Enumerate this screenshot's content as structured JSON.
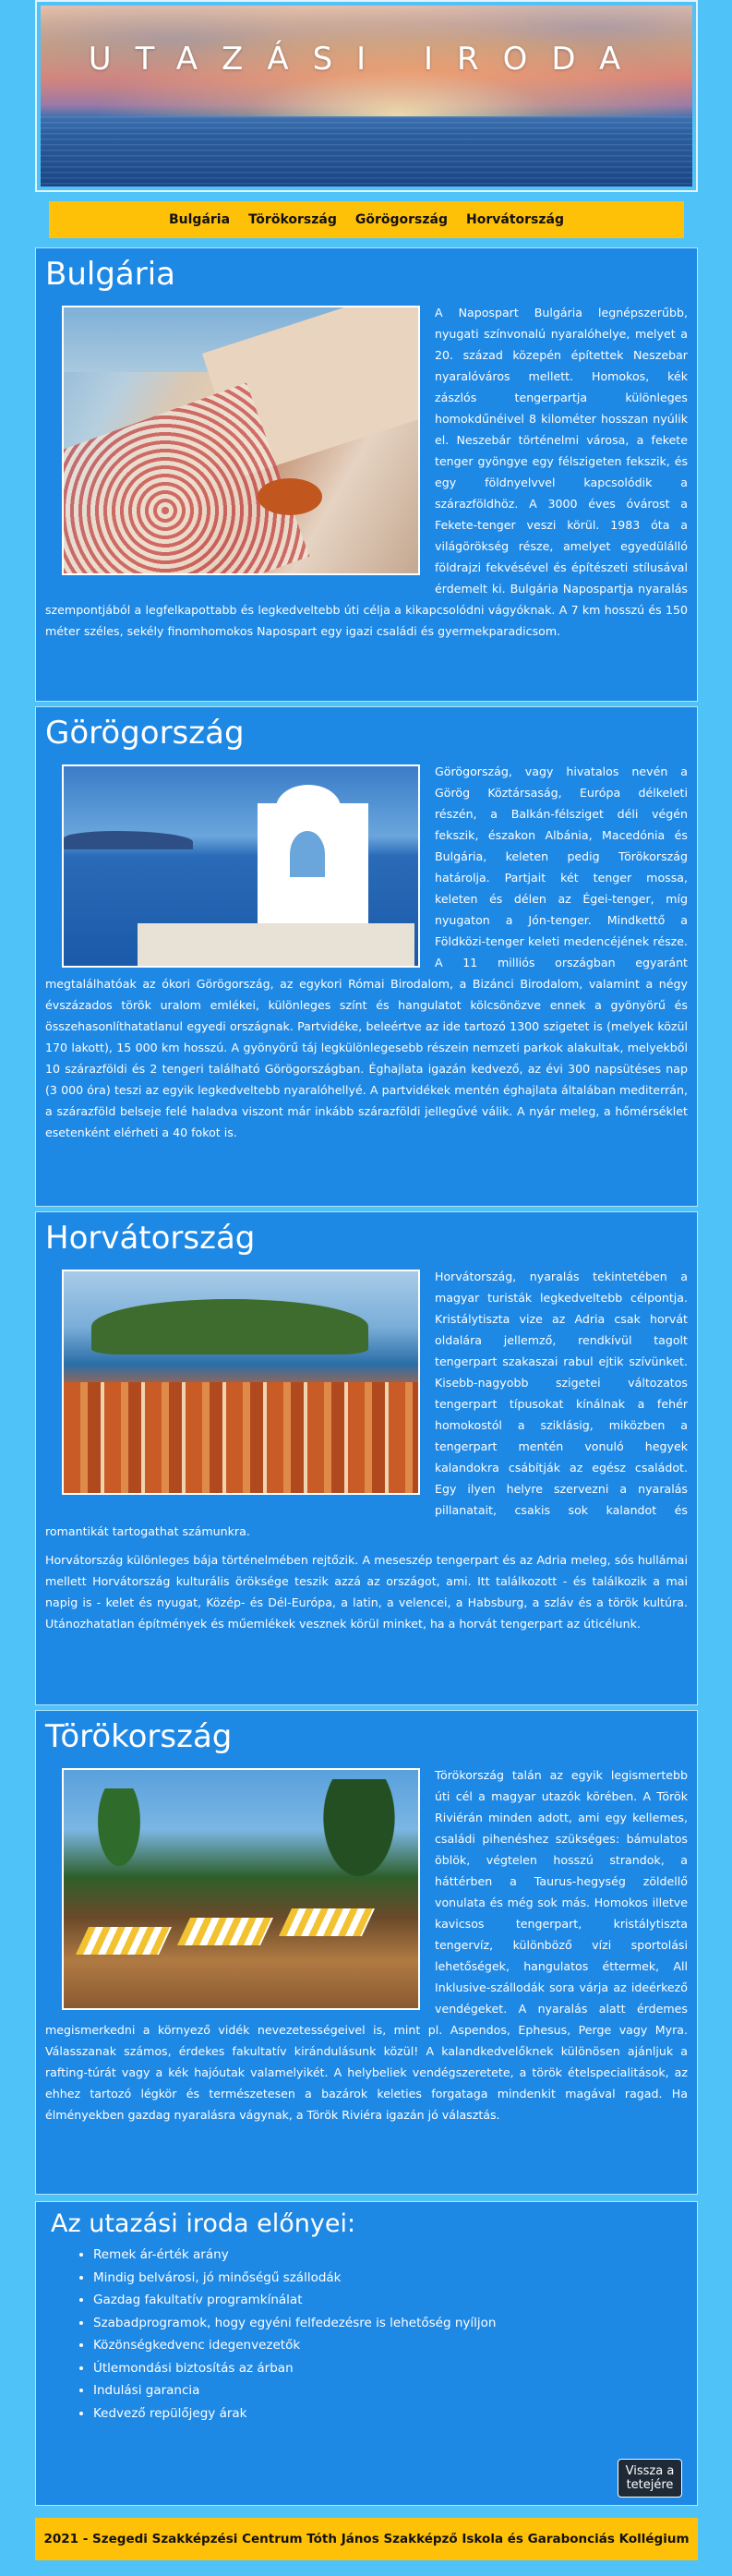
{
  "header": {
    "title": "UTAZÁSI IRODA"
  },
  "nav": [
    "Bulgária",
    "Törökország",
    "Görögország",
    "Horvátország"
  ],
  "sections": {
    "bulgaria": {
      "title": "Bulgária",
      "text": "A Napospart Bulgária legnépszerűbb, nyugati színvonalú nyaralóhelye, melyet a 20. század közepén építettek Neszebar nyaralóváros mellett. Homokos, kék zászlós tengerpartja különleges homokdűnéivel 8 kilométer hosszan nyúlik el. Neszebár történelmi városa, a fekete tenger gyöngye egy félszigeten fekszik, és egy földnyelvvel kapcsolódik a szárazföldhöz. A 3000 éves óvárost a Fekete-tenger veszi körül. 1983 óta a világörökség része, amelyet egyedülálló földrajzi fekvésével és építészeti stílusával érdemelt ki. Bulgária Napospartja nyaralás szempontjából a legfelkapottabb és legkedveltebb úti célja a kikapcsolódni vágyóknak. A 7 km hosszú és 150 méter széles, sekély finomhomokos Napospart egy igazi családi és gyermekparadicsom."
    },
    "greece": {
      "title": "Görögország",
      "text": "Görögország, vagy hivatalos nevén a Görög Köztársaság, Európa délkeleti részén, a Balkán-félsziget déli végén fekszik, északon Albánia, Macedónia és Bulgária, keleten pedig Törökország határolja. Partjait két tenger mossa, keleten és délen az Égei-tenger, míg nyugaton a Jón-tenger. Mindkettő a Földközi-tenger keleti medencéjének része. A 11 milliós országban egyaránt megtalálhatóak az ókori Görögország, az egykori Római Birodalom, a Bizánci Birodalom, valamint a négy évszázados török uralom emlékei, különleges színt és hangulatot kölcsönözve ennek a gyönyörű és összehasonlíthatatlanul egyedi országnak. Partvidéke, beleértve az ide tartozó 1300 szigetet is (melyek közül 170 lakott), 15 000 km hosszú. A gyönyörű táj legkülönlegesebb részein nemzeti parkok alakultak, melyekből 10 szárazföldi és 2 tengeri található Görögországban. Éghajlata igazán kedvező, az évi 300 napsütéses nap (3 000 óra) teszi az egyik legkedveltebb nyaralóhellyé. A partvidékek mentén éghajlata általában mediterrán, a szárazföld belseje felé haladva viszont már inkább szárazföldi jellegűvé válik. A nyár meleg, a hőmérséklet esetenként elérheti a 40 fokot is."
    },
    "croatia": {
      "title": "Horvátország",
      "text1": "Horvátország, nyaralás tekintetében a magyar turisták legkedveltebb célpontja. Kristálytiszta vize az Adria csak horvát oldalára jellemző, rendkívül tagolt tengerpart szakaszai rabul ejtik szívünket. Kisebb-nagyobb szigetei változatos tengerpart típusokat kínálnak a fehér homokostól a sziklásig, miközben a tengerpart mentén vonuló hegyek kalandokra csábítják az egész családot. Egy ilyen helyre szervezni a nyaralás pillanatait, csakis sok kalandot és romantikát tartogathat számunkra.",
      "text2": "Horvátország különleges bája történelmében rejtőzik. A meseszép tengerpart és az Adria meleg, sós hullámai mellett Horvátország kulturális öröksége teszik azzá az országot, ami. Itt találkozott - és találkozik a mai napig is - kelet és nyugat, Közép- és Dél-Európa, a latin, a velencei, a Habsburg, a szláv és a török kultúra. Utánozhatatlan építmények és műemlékek vesznek körül minket, ha a horvát tengerpart az úticélunk."
    },
    "turkey": {
      "title": "Törökország",
      "text": "Törökország talán az egyik legismertebb úti cél a magyar utazók körében. A Török Riviérán minden adott, ami egy kellemes, családi pihenéshez szükséges: bámulatos öblök, végtelen hosszú strandok, a háttérben a Taurus-hegység zöldellő vonulata és még sok más. Homokos illetve kavicsos tengerpart, kristálytiszta tengervíz, különböző vízi sportolási lehetőségek, hangulatos éttermek, All Inklusive-szállodák sora várja az ideérkező vendégeket. A nyaralás alatt érdemes megismerkedni a környező vidék nevezetességeivel is, mint pl. Aspendos, Ephesus, Perge vagy Myra. Válasszanak számos, érdekes fakultatív kirándulásunk közül! A kalandkedvelőknek különösen ajánljuk a rafting-túrát vagy a kék hajóutak valamelyikét. A helybeliek vendégszeretete, a török ételspecialitások, az ehhez tartozó légkör és természetesen a bazárok keleties forgataga mindenkit magával ragad. Ha élményekben gazdag nyaralásra vágynak, a Török Riviéra igazán jó választás."
    }
  },
  "benefits": {
    "title": "Az utazási iroda előnyei:",
    "items": [
      "Remek ár-érték arány",
      "Mindig belvárosi, jó minőségű szállodák",
      "Gazdag fakultatív programkínálat",
      "Szabadprogramok, hogy egyéni felfedezésre is lehetőség nyíljon",
      "Közönségkedvenc idegenvezetők",
      "Útlemondási biztosítás az árban",
      "Indulási garancia",
      "Kedvező repülőjegy árak"
    ],
    "back_button": "Vissza a tetejére"
  },
  "footer": {
    "text": "2021 - Szegedi Szakképzési Centrum Tóth János Szakképző Iskola és Garabonciás Kollégium"
  },
  "colors": {
    "background": "#4fc3f7",
    "section": "#1e88e5",
    "nav": "#ffc107",
    "button": "#1f2a36"
  }
}
